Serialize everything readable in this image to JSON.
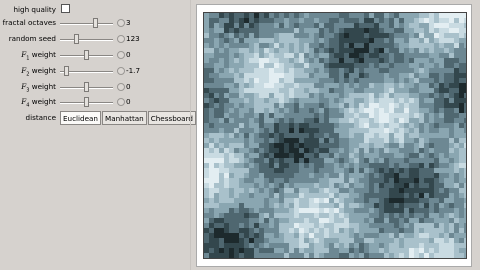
{
  "controls": {
    "high_quality": {
      "label": "high quality",
      "checked": false
    },
    "fractal_octaves": {
      "label": "fractal octaves",
      "value": "3",
      "fraction": 0.68
    },
    "random_seed": {
      "label": "random seed",
      "value": "123",
      "fraction": 0.3
    },
    "f1": {
      "prefix": "F",
      "sub": "1",
      "suffix": " weight",
      "value": "0",
      "fraction": 0.5
    },
    "f2": {
      "prefix": "F",
      "sub": "2",
      "suffix": " weight",
      "value": "-1.7",
      "fraction": 0.08
    },
    "f3": {
      "prefix": "F",
      "sub": "3",
      "suffix": " weight",
      "value": "0",
      "fraction": 0.5
    },
    "f4": {
      "prefix": "F",
      "sub": "4",
      "suffix": " weight",
      "value": "0",
      "fraction": 0.5
    },
    "distance": {
      "label": "distance",
      "options": [
        "Euclidean",
        "Manhattan",
        "Chessboard"
      ],
      "selected": "Euclidean"
    }
  },
  "colors": {
    "panel": "#d6d2ce",
    "texture_light": "#c9dbe2",
    "texture_dark": "#1d2a2d"
  }
}
